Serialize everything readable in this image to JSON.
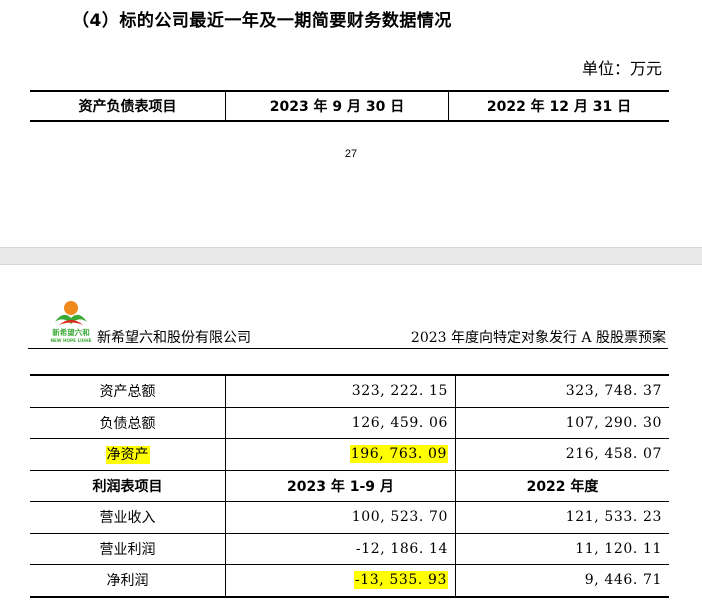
{
  "heading": "（4）标的公司最近一年及一期简要财务数据情况",
  "unit_label": "单位：万元",
  "top_table": {
    "headers": [
      "资产负债表项目",
      "2023 年 9 月 30 日",
      "2022 年 12 月 31 日"
    ]
  },
  "page_number": "27",
  "page_header": {
    "logo_text": "新希望六和",
    "logo_subtext": "NEW HOPE LIUHE",
    "company": "新希望六和股份有限公司",
    "doc_title": "2023 年度向特定对象发行 A 股股票预案"
  },
  "balance_rows": [
    {
      "label": "资产总额",
      "v2023": "323, 222. 15",
      "v2022": "323, 748. 37"
    },
    {
      "label": "负债总额",
      "v2023": "126, 459. 06",
      "v2022": "107, 290. 30"
    },
    {
      "label": "净资产",
      "v2023": "196, 763. 09",
      "v2022": "216, 458. 07"
    }
  ],
  "income_header": [
    "利润表项目",
    "2023 年 1-9 月",
    "2022 年度"
  ],
  "income_rows": [
    {
      "label": "营业收入",
      "v2023": "100, 523. 70",
      "v2022": "121, 533. 23"
    },
    {
      "label": "营业利润",
      "v2023": "-12, 186. 14",
      "v2022": "11, 120. 11"
    },
    {
      "label": "净利润",
      "v2023": "-13, 535. 93",
      "v2022": "9, 446. 71"
    }
  ],
  "colors": {
    "highlight": "#ffff00",
    "logo_green": "#3aa935",
    "logo_orange": "#f08a1c",
    "logo_red": "#e2231a"
  }
}
